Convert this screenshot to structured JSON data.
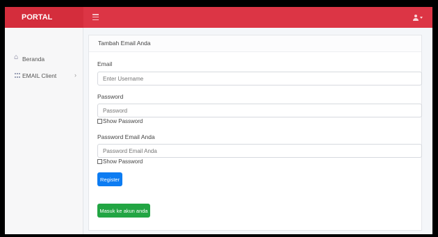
{
  "header": {
    "brand": "PORTAL"
  },
  "sidebar": {
    "items": [
      {
        "label": "Beranda"
      },
      {
        "label": "EMAIL Client",
        "arrow": "›"
      }
    ]
  },
  "card": {
    "title": "Tambah Email Anda",
    "email": {
      "label": "Email",
      "placeholder": "Enter Username"
    },
    "password": {
      "label": "Password",
      "placeholder": "Password",
      "show": "Show Password"
    },
    "email_password": {
      "label": "Password Email Anda",
      "placeholder": "Password Email Anda",
      "show": "Show Password"
    },
    "register_label": "Register",
    "login_label": "Masuk ke akun anda"
  },
  "colors": {
    "accent": "#dc3545",
    "primary": "#0d7cf2",
    "success": "#22a543"
  }
}
